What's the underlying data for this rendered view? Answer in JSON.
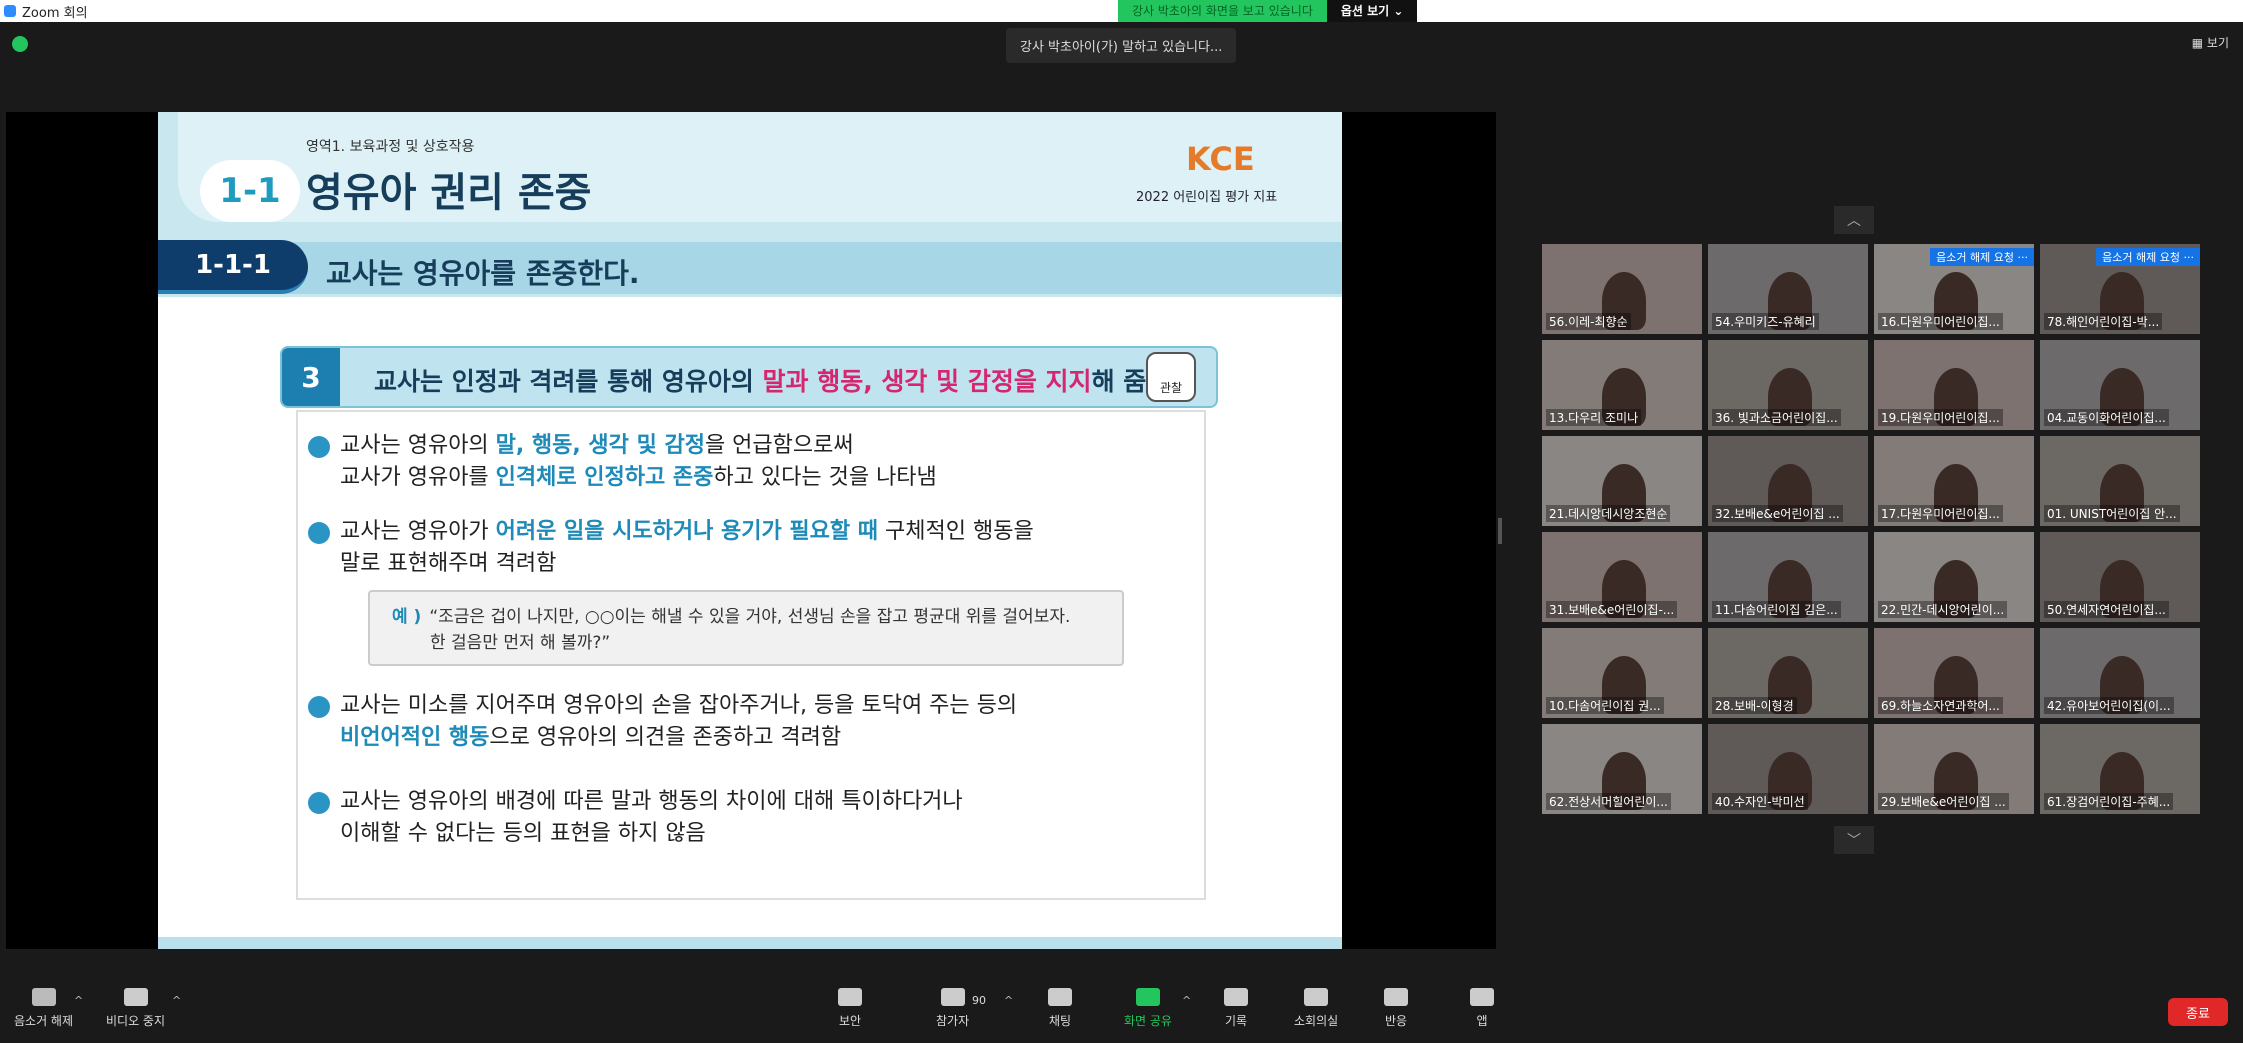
{
  "window": {
    "title": "Zoom 회의"
  },
  "share": {
    "message": "강사 박초아의 화면을 보고 있습니다",
    "options": "옵션 보기 ⌄"
  },
  "speaking": "강사 박초아이(가) 말하고 있습니다...",
  "view_label": "보기",
  "slide": {
    "area": "영역1. 보육과정 및 상호작용",
    "badge": "1-1",
    "title": "영유아 권리 존중",
    "logo": "KCE",
    "logo_sub": "2022 어린이집 평가 지표",
    "code": "1-1-1",
    "code_title": "교사는 영유아를 존중한다.",
    "indicator_num": "3",
    "indicator_pre": "교사는 인정과 격려를 통해 영유아의 ",
    "indicator_hl": "말과 행동, 생각 및 감정을 지지",
    "indicator_post": "해 줌",
    "obs_label": "관찰",
    "items": [
      {
        "a": "교사는 영유아의 ",
        "b": "말, 행동, 생각 및 감정",
        "c": "을 언급함으로써",
        "d": "교사가 영유아를 ",
        "e": "인격체로 인정하고 존중",
        "f": "하고 있다는 것을 나타냄"
      },
      {
        "a": "교사는 영유아가 ",
        "b": "어려운 일을 시도하거나 용기가 필요할 때",
        "c": " 구체적인 행동을",
        "d": "말로 표현해주며 격려함"
      },
      {
        "a": "교사는 미소를 지어주며 영유아의 손을 잡아주거나, 등을 토닥여 주는 등의",
        "b": "비언어적인 행동",
        "c": "으로 영유아의 의견을 존중하고 격려함"
      },
      {
        "a": "교사는 영유아의 배경에 따른 말과 행동의 차이에 대해 특이하다거나",
        "b": "이해할 수 없다는 등의 표현을 하지 않음"
      }
    ],
    "example_label": "예 )",
    "example_1": "“조금은 겁이 나지만, ○○이는 해낼 수 있을 거야, 선생님 손을 잡고 평균대 위를 걸어보자.",
    "example_2": "한 걸음만 먼저 해 볼까?”"
  },
  "participants": [
    {
      "name": "56.이레-최향순",
      "req": ""
    },
    {
      "name": "54.우미키즈-유혜리",
      "req": ""
    },
    {
      "name": "16.다원우미어린이집...",
      "req": "음소거 해제 요청  ···"
    },
    {
      "name": "78.해인어린이집-박...",
      "req": "음소거 해제 요청  ···"
    },
    {
      "name": "13.다우리 조미나",
      "req": ""
    },
    {
      "name": "36. 빛과소금어린이집...",
      "req": ""
    },
    {
      "name": "19.다원우미어린이집...",
      "req": ""
    },
    {
      "name": "04.교동이화어린이집...",
      "req": ""
    },
    {
      "name": "21.데시앙데시앙조현순",
      "req": ""
    },
    {
      "name": "32.보배e&e어린이집 ...",
      "req": ""
    },
    {
      "name": "17.다원우미어린이집...",
      "req": ""
    },
    {
      "name": "01. UNIST어린이집 안...",
      "req": ""
    },
    {
      "name": "31.보배e&e어린이집-...",
      "req": ""
    },
    {
      "name": "11.다솜어린이집 김은...",
      "req": ""
    },
    {
      "name": "22.민간-데시앙어린이...",
      "req": ""
    },
    {
      "name": "50.연세자연어린이집...",
      "req": ""
    },
    {
      "name": "10.다솜어린이집 권...",
      "req": ""
    },
    {
      "name": "28.보배-이형경",
      "req": ""
    },
    {
      "name": "69.하늘소자연과학어...",
      "req": ""
    },
    {
      "name": "42.유아보어린이집(이...",
      "req": ""
    },
    {
      "name": "62.전상서머힐어린이...",
      "req": ""
    },
    {
      "name": "40.수자인-박미선",
      "req": ""
    },
    {
      "name": "29.보배e&e어린이집 ...",
      "req": ""
    },
    {
      "name": "61.장검어린이집-주혜...",
      "req": ""
    }
  ],
  "toolbar": {
    "unmute": "음소거 해제",
    "video": "비디오 중지",
    "security": "보안",
    "participants": "참가자",
    "participants_count": "90",
    "chat": "채팅",
    "share": "화면 공유",
    "record": "기록",
    "breakout": "소회의실",
    "reactions": "반응",
    "apps": "앱",
    "end": "종료"
  }
}
